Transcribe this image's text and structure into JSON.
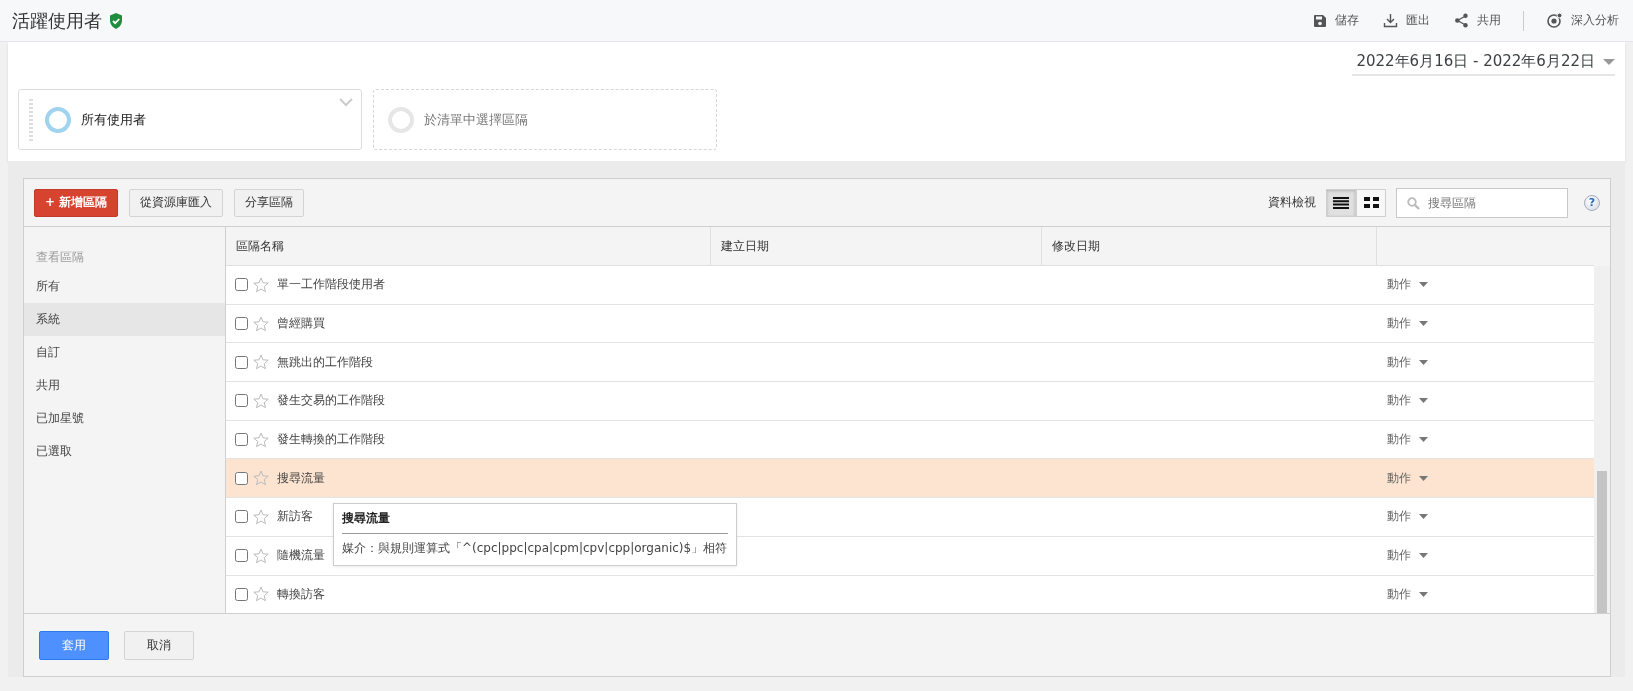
{
  "header": {
    "title": "活躍使用者",
    "verified": true,
    "actions": [
      {
        "label": "儲存",
        "kind": "save"
      },
      {
        "label": "匯出",
        "kind": "download"
      },
      {
        "label": "共用",
        "kind": "share"
      },
      {
        "label": "深入分析",
        "kind": "insights"
      }
    ]
  },
  "date_range": "2022年6月16日 - 2022年6月22日",
  "segments": [
    {
      "label": "所有使用者",
      "kind": "active"
    },
    {
      "label": "於清單中選擇區隔",
      "kind": "placeholder"
    }
  ],
  "toolbar": {
    "buttons": [
      {
        "label": "+ 新增區隔",
        "kind": "primary"
      },
      {
        "label": "從資源庫匯入",
        "kind": "plain"
      },
      {
        "label": "分享區隔",
        "kind": "plain"
      }
    ],
    "view_label": "資料檢視",
    "views": [
      {
        "kind": "list",
        "selected": true
      },
      {
        "kind": "grid",
        "selected": false
      }
    ],
    "search": {
      "placeholder": "搜尋區隔"
    },
    "help": "?"
  },
  "sidebar": {
    "heading": "查看區隔",
    "items": [
      {
        "label": "所有",
        "selected": false
      },
      {
        "label": "系統",
        "selected": true
      },
      {
        "label": "自訂",
        "selected": false
      },
      {
        "label": "共用",
        "selected": false
      },
      {
        "label": "已加星號",
        "selected": false
      },
      {
        "label": "已選取",
        "selected": false
      }
    ]
  },
  "table": {
    "columns": [
      "區隔名稱",
      "建立日期",
      "修改日期"
    ],
    "rows": [
      {
        "name": "單一工作階段使用者",
        "checked": false,
        "starred": false,
        "selected": false,
        "action": "動作"
      },
      {
        "name": "曾經購買",
        "checked": false,
        "starred": false,
        "selected": false,
        "action": "動作"
      },
      {
        "name": "無跳出的工作階段",
        "checked": false,
        "starred": false,
        "selected": false,
        "action": "動作"
      },
      {
        "name": "發生交易的工作階段",
        "checked": false,
        "starred": false,
        "selected": false,
        "action": "動作"
      },
      {
        "name": "發生轉換的工作階段",
        "checked": false,
        "starred": false,
        "selected": false,
        "action": "動作"
      },
      {
        "name": "搜尋流量",
        "checked": false,
        "starred": false,
        "selected": true,
        "action": "動作"
      },
      {
        "name": "新訪客",
        "checked": false,
        "starred": false,
        "selected": false,
        "action": "動作"
      },
      {
        "name": "隨機流量",
        "checked": false,
        "starred": false,
        "selected": false,
        "action": "動作"
      },
      {
        "name": "轉換訪客",
        "checked": false,
        "starred": false,
        "selected": false,
        "action": "動作"
      }
    ]
  },
  "tooltip": {
    "title": "搜尋流量",
    "text": "媒介：與規則運算式「^(cpc|ppc|cpa|cpm|cpv|cpp|organic)$」相符"
  },
  "footer": {
    "buttons": [
      {
        "label": "套用",
        "kind": "primary"
      },
      {
        "label": "取消",
        "kind": "plain"
      }
    ]
  }
}
